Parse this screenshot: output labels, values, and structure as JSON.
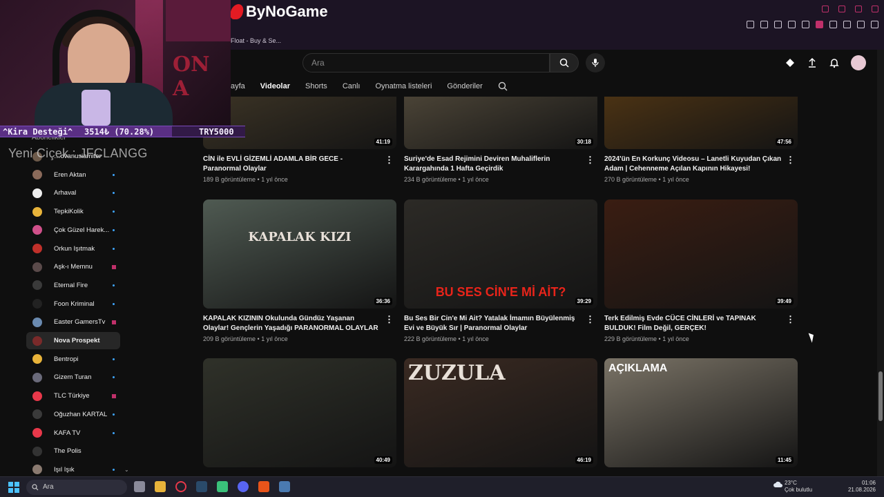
{
  "browser": {
    "site_brand": "ByNoGame",
    "tab_title": "Float - Buy & Se..."
  },
  "youtube": {
    "search": {
      "placeholder": "Ara"
    },
    "channel_tabs": [
      {
        "label": "ayfa",
        "active": false
      },
      {
        "label": "Videolar",
        "active": true
      },
      {
        "label": "Shorts",
        "active": false
      },
      {
        "label": "Canlı",
        "active": false
      },
      {
        "label": "Oynatma listeleri",
        "active": false
      },
      {
        "label": "Gönderiler",
        "active": false
      }
    ],
    "sidebar": {
      "section_label": "Abonelikler",
      "items": [
        {
          "label": "…ovanusiamiter",
          "indicator": "none",
          "color": "#6d5a4a"
        },
        {
          "label": "Eren Aktan",
          "indicator": "dot",
          "color": "#8a6a5a"
        },
        {
          "label": "Arhaval",
          "indicator": "dot",
          "color": "#eeeeee"
        },
        {
          "label": "TepkiKolik",
          "indicator": "dot",
          "color": "#e8b33a"
        },
        {
          "label": "Çok Güzel Harek...",
          "indicator": "dot",
          "color": "#d0508a"
        },
        {
          "label": "Orkun Işıtmak",
          "indicator": "dot",
          "color": "#c0302a"
        },
        {
          "label": "Aşk-ı Memnu",
          "indicator": "live",
          "color": "#5a4a4a"
        },
        {
          "label": "Eternal Fire",
          "indicator": "dot",
          "color": "#3a3a3a"
        },
        {
          "label": "Foon Kriminal",
          "indicator": "dot",
          "color": "#222222"
        },
        {
          "label": "Easter GamersTv",
          "indicator": "live",
          "color": "#6a8ab0"
        },
        {
          "label": "Nova Prospekt",
          "indicator": "none",
          "color": "#7a2a2a",
          "selected": true
        },
        {
          "label": "Bentropi",
          "indicator": "dot",
          "color": "#e8b33a"
        },
        {
          "label": "Gizem Turan",
          "indicator": "dot",
          "color": "#6a6a7a"
        },
        {
          "label": "TLC Türkiye",
          "indicator": "live",
          "color": "#e8384a"
        },
        {
          "label": "Oğuzhan KARTAL",
          "indicator": "dot",
          "color": "#3a3a3a"
        },
        {
          "label": "KAFA TV",
          "indicator": "dot",
          "color": "#e8384a"
        },
        {
          "label": "The Polis",
          "indicator": "none",
          "color": "#333333"
        },
        {
          "label": "Işıl Işık",
          "indicator": "dot",
          "color": "#8a7a70"
        }
      ]
    },
    "videos": [
      {
        "title": "CİN ile EVLİ GİZEMLİ ADAMLA BİR GECE - Paranormal Olaylar",
        "meta": "189 B görüntüleme • 1 yıl önce",
        "duration": "41:19",
        "overlay": "",
        "bg": "#3b3325"
      },
      {
        "title": "Suriye'de Esad Rejimini Deviren Muhaliflerin Karargahında 1 Hafta Geçirdik",
        "meta": "234 B görüntüleme • 1 yıl önce",
        "duration": "30:18",
        "overlay": "",
        "bg": "#4a4336"
      },
      {
        "title": "2024'ün En Korkunç Videosu – Lanetli Kuyudan Çıkan Adam | Cehenneme Açılan Kapının Hikayesi!",
        "meta": "270 B görüntüleme • 1 yıl önce",
        "duration": "47:56",
        "overlay": "",
        "bg": "#4a3214"
      },
      {
        "title": "KAPALAK KIZININ Okulunda Gündüz Yaşanan Olaylar! Gençlerin Yaşadığı PARANORMAL OLAYLAR",
        "meta": "209 B görüntüleme • 1 yıl önce",
        "duration": "36:36",
        "overlay": "KAPALAK KIZI",
        "bg": "#4f5a52"
      },
      {
        "title": "Bu Ses Bir Cin'e Mi Ait? Yatalak İmamın Büyülenmiş Evi ve Büyük Sır | Paranormal Olaylar",
        "meta": "222 B görüntüleme • 1 yıl önce",
        "duration": "39:29",
        "overlay": "BU SES CİN'E Mİ AİT?",
        "bg": "#2c2a26"
      },
      {
        "title": "Terk Edilmiş Evde CÜCE CİNLERİ ve TAPINAK BULDUK! Film Değil, GERÇEK!",
        "meta": "229 B görüntüleme • 1 yıl önce",
        "duration": "39:49",
        "overlay": "",
        "bg": "#3a1d12"
      },
      {
        "title": "",
        "meta": "",
        "duration": "40:49",
        "overlay": "",
        "bg": "#2f3129"
      },
      {
        "title": "",
        "meta": "",
        "duration": "46:19",
        "overlay": "ZUZULA",
        "bg": "#3a2a22"
      },
      {
        "title": "",
        "meta": "",
        "duration": "11:45",
        "overlay": "AÇIKLAMA",
        "bg": "#7a7366"
      }
    ]
  },
  "stream_overlay": {
    "goal_label": "^Kira Desteği^",
    "goal_amount": "3514₺ (70.28%)",
    "goal_fraction": 0.7028,
    "goal_target": "TRY5000",
    "new_sub": "Yeni Ciçek : JFCLANGG",
    "backdrop_text": "ON A"
  },
  "taskbar": {
    "search_label": "Ara",
    "weather_temp": "23°C",
    "weather_desc": "Çok bulutlu",
    "time": "01:06",
    "date": "21.08.2026"
  }
}
